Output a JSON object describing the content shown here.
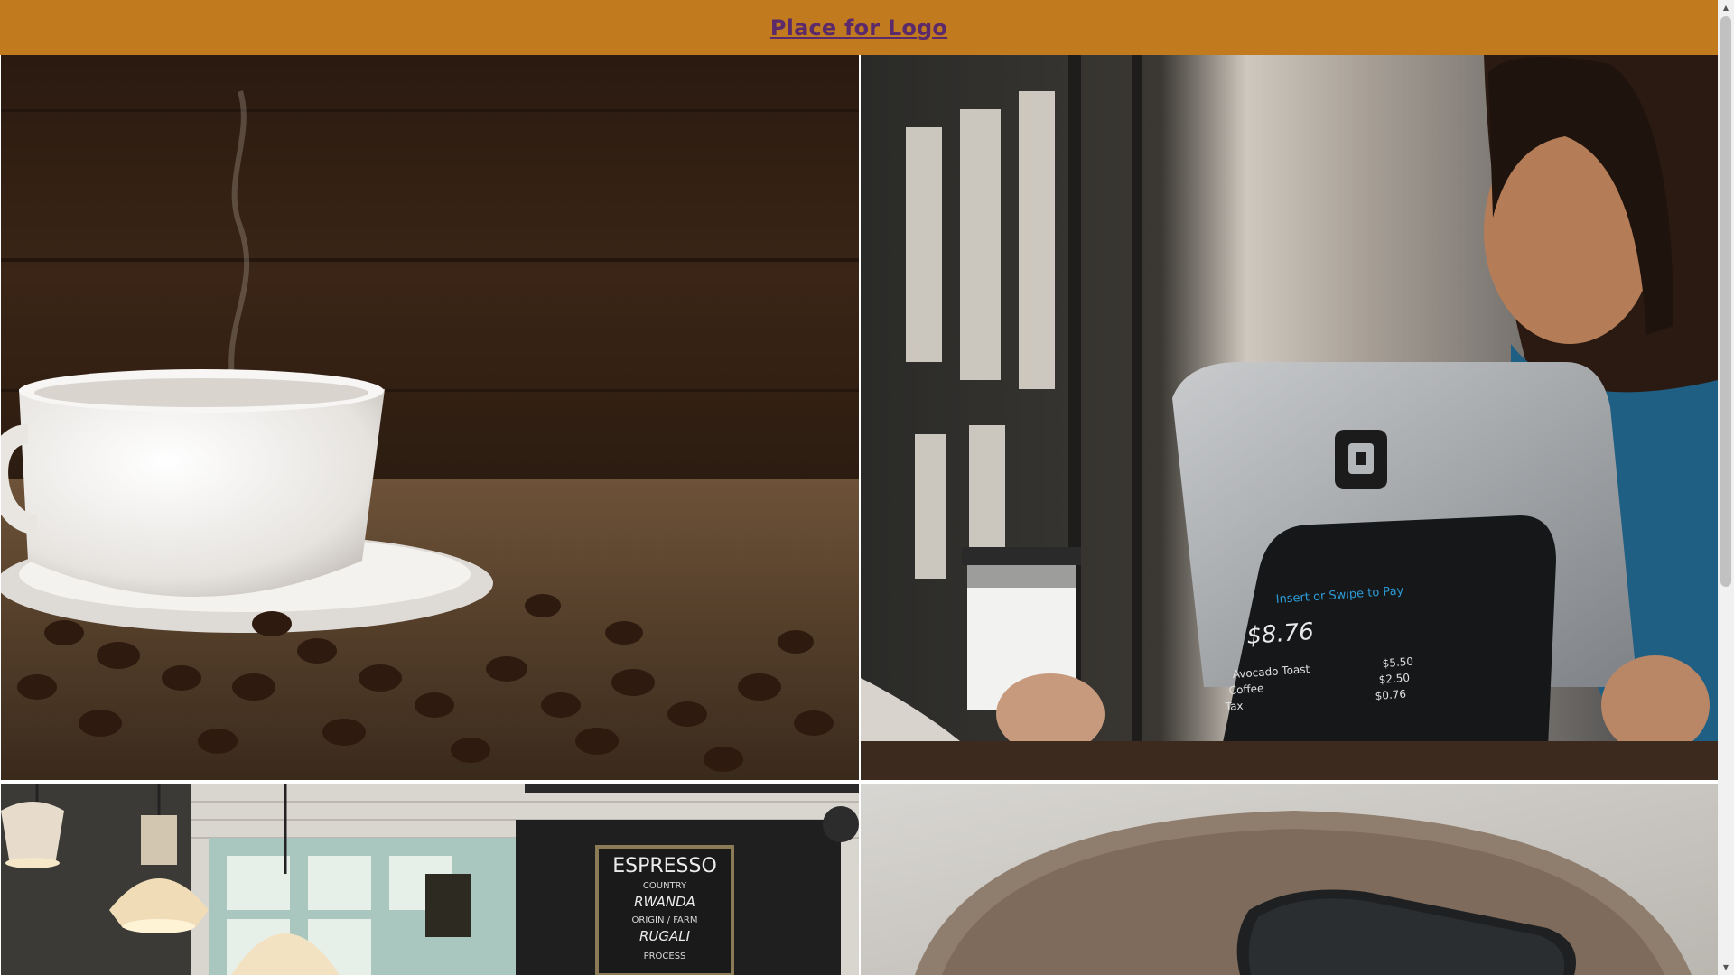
{
  "header": {
    "logo_text": "Place for Logo",
    "background_color": "#c27a1e",
    "logo_color": "#5b2a6b"
  },
  "gallery": {
    "tiles": [
      {
        "name": "coffee-cup-beans-photo",
        "subject": "coffee-cup-with-beans"
      },
      {
        "name": "cafe-checkout-photo",
        "subject": "woman-at-payment-tablet",
        "screen": {
          "prompt": "Insert or Swipe to Pay",
          "total": "$8.76",
          "items": [
            {
              "label": "Avocado Toast",
              "price": "$5.50"
            },
            {
              "label": "Coffee",
              "price": "$2.50"
            },
            {
              "label": "Tax",
              "price": "$0.76"
            }
          ]
        }
      },
      {
        "name": "cafe-interior-photo",
        "subject": "cafe-interior-lamps",
        "sign": {
          "title": "ESPRESSO",
          "lines": [
            "COUNTRY",
            "RWANDA",
            "ORIGIN / FARM",
            "RUGALI",
            "PROCESS"
          ]
        }
      },
      {
        "name": "table-phone-photo",
        "subject": "phone-on-wooden-table"
      }
    ]
  },
  "scrollbar": {
    "up_icon": "triangle-up-icon",
    "down_icon": "triangle-down-icon"
  }
}
